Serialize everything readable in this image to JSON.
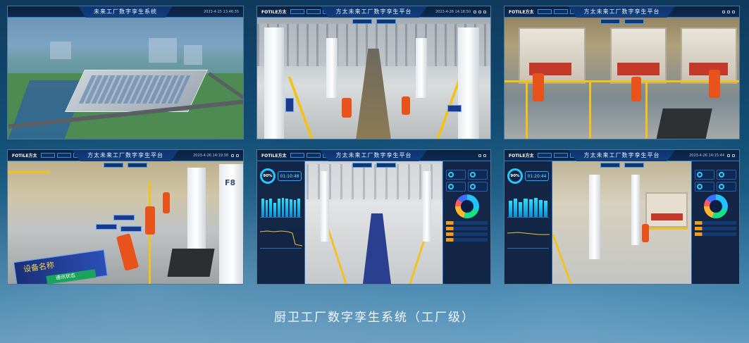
{
  "panels": {
    "p1": {
      "hud_title": "未来工厂数字孪生系统",
      "hud_time": "2023-4-25 13:46:35"
    },
    "p2": {
      "hud_logo": "FOTILE方太",
      "hud_title": "方太未来工厂数字孪生平台",
      "hud_time": "2023-4-26 14:18:50"
    },
    "p3": {
      "hud_logo": "FOTILE方太",
      "hud_title": "方太未来工厂数字孪生平台"
    },
    "p4": {
      "hud_logo": "FOTILE方太",
      "hud_title": "方太未来工厂数字孪生平台",
      "hud_time": "2023-4-26 14:19:38",
      "column_label": "F8",
      "device_label": "设备名称",
      "status_label": "通讯状态"
    },
    "p5": {
      "hud_logo": "FOTILE方太",
      "hud_title": "方太未来工厂数字孪生平台",
      "ring_value": "90%",
      "timer_value": "01:10:48",
      "bar_values": [
        0.78,
        0.72,
        0.8,
        0.62,
        0.78,
        0.82,
        0.78,
        0.76,
        0.74,
        0.8
      ]
    },
    "p6": {
      "hud_logo": "FOTILE方太",
      "hud_title": "方太未来工厂数字孪生平台",
      "hud_time": "2023-4-26 14:15:44",
      "ring_value": "90%",
      "timer_value": "01:20:44",
      "bar_values": [
        0.7,
        0.8,
        0.65,
        0.78,
        0.75,
        0.82,
        0.72,
        0.7
      ]
    }
  },
  "caption": "厨卫工厂数字孪生系统（工厂级）",
  "colors": {
    "accent": "#29c5ff",
    "robot": "#e8531c",
    "safety": "#f2c21b"
  }
}
